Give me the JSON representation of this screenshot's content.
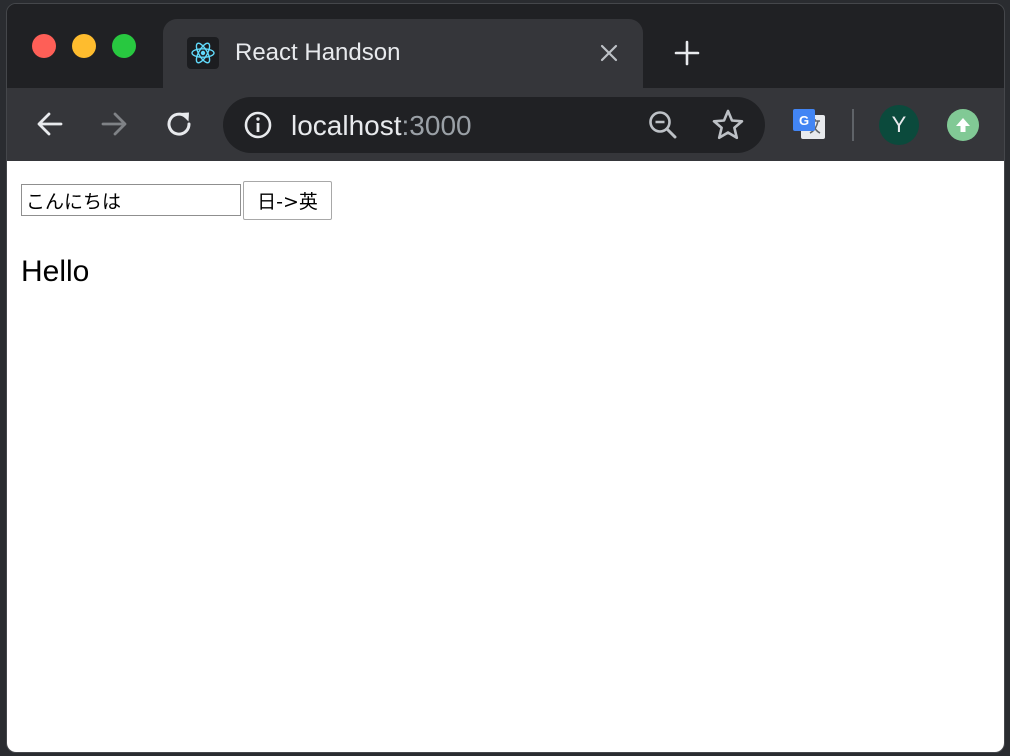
{
  "browser": {
    "tab": {
      "title": "React Handson",
      "favicon": "react-logo-icon"
    },
    "address_bar": {
      "host": "localhost",
      "port": ":3000"
    },
    "profile": {
      "initial": "Y"
    },
    "colors": {
      "frame": "#202124",
      "toolbar": "#35363a",
      "close": "#fe5f57",
      "minimize": "#febc2e",
      "maximize": "#28c840",
      "avatar": "#0b4a3c",
      "update": "#81c995"
    }
  },
  "page": {
    "input_value": "こんにちは",
    "translate_button_label": "日->英",
    "result_text": "Hello"
  }
}
